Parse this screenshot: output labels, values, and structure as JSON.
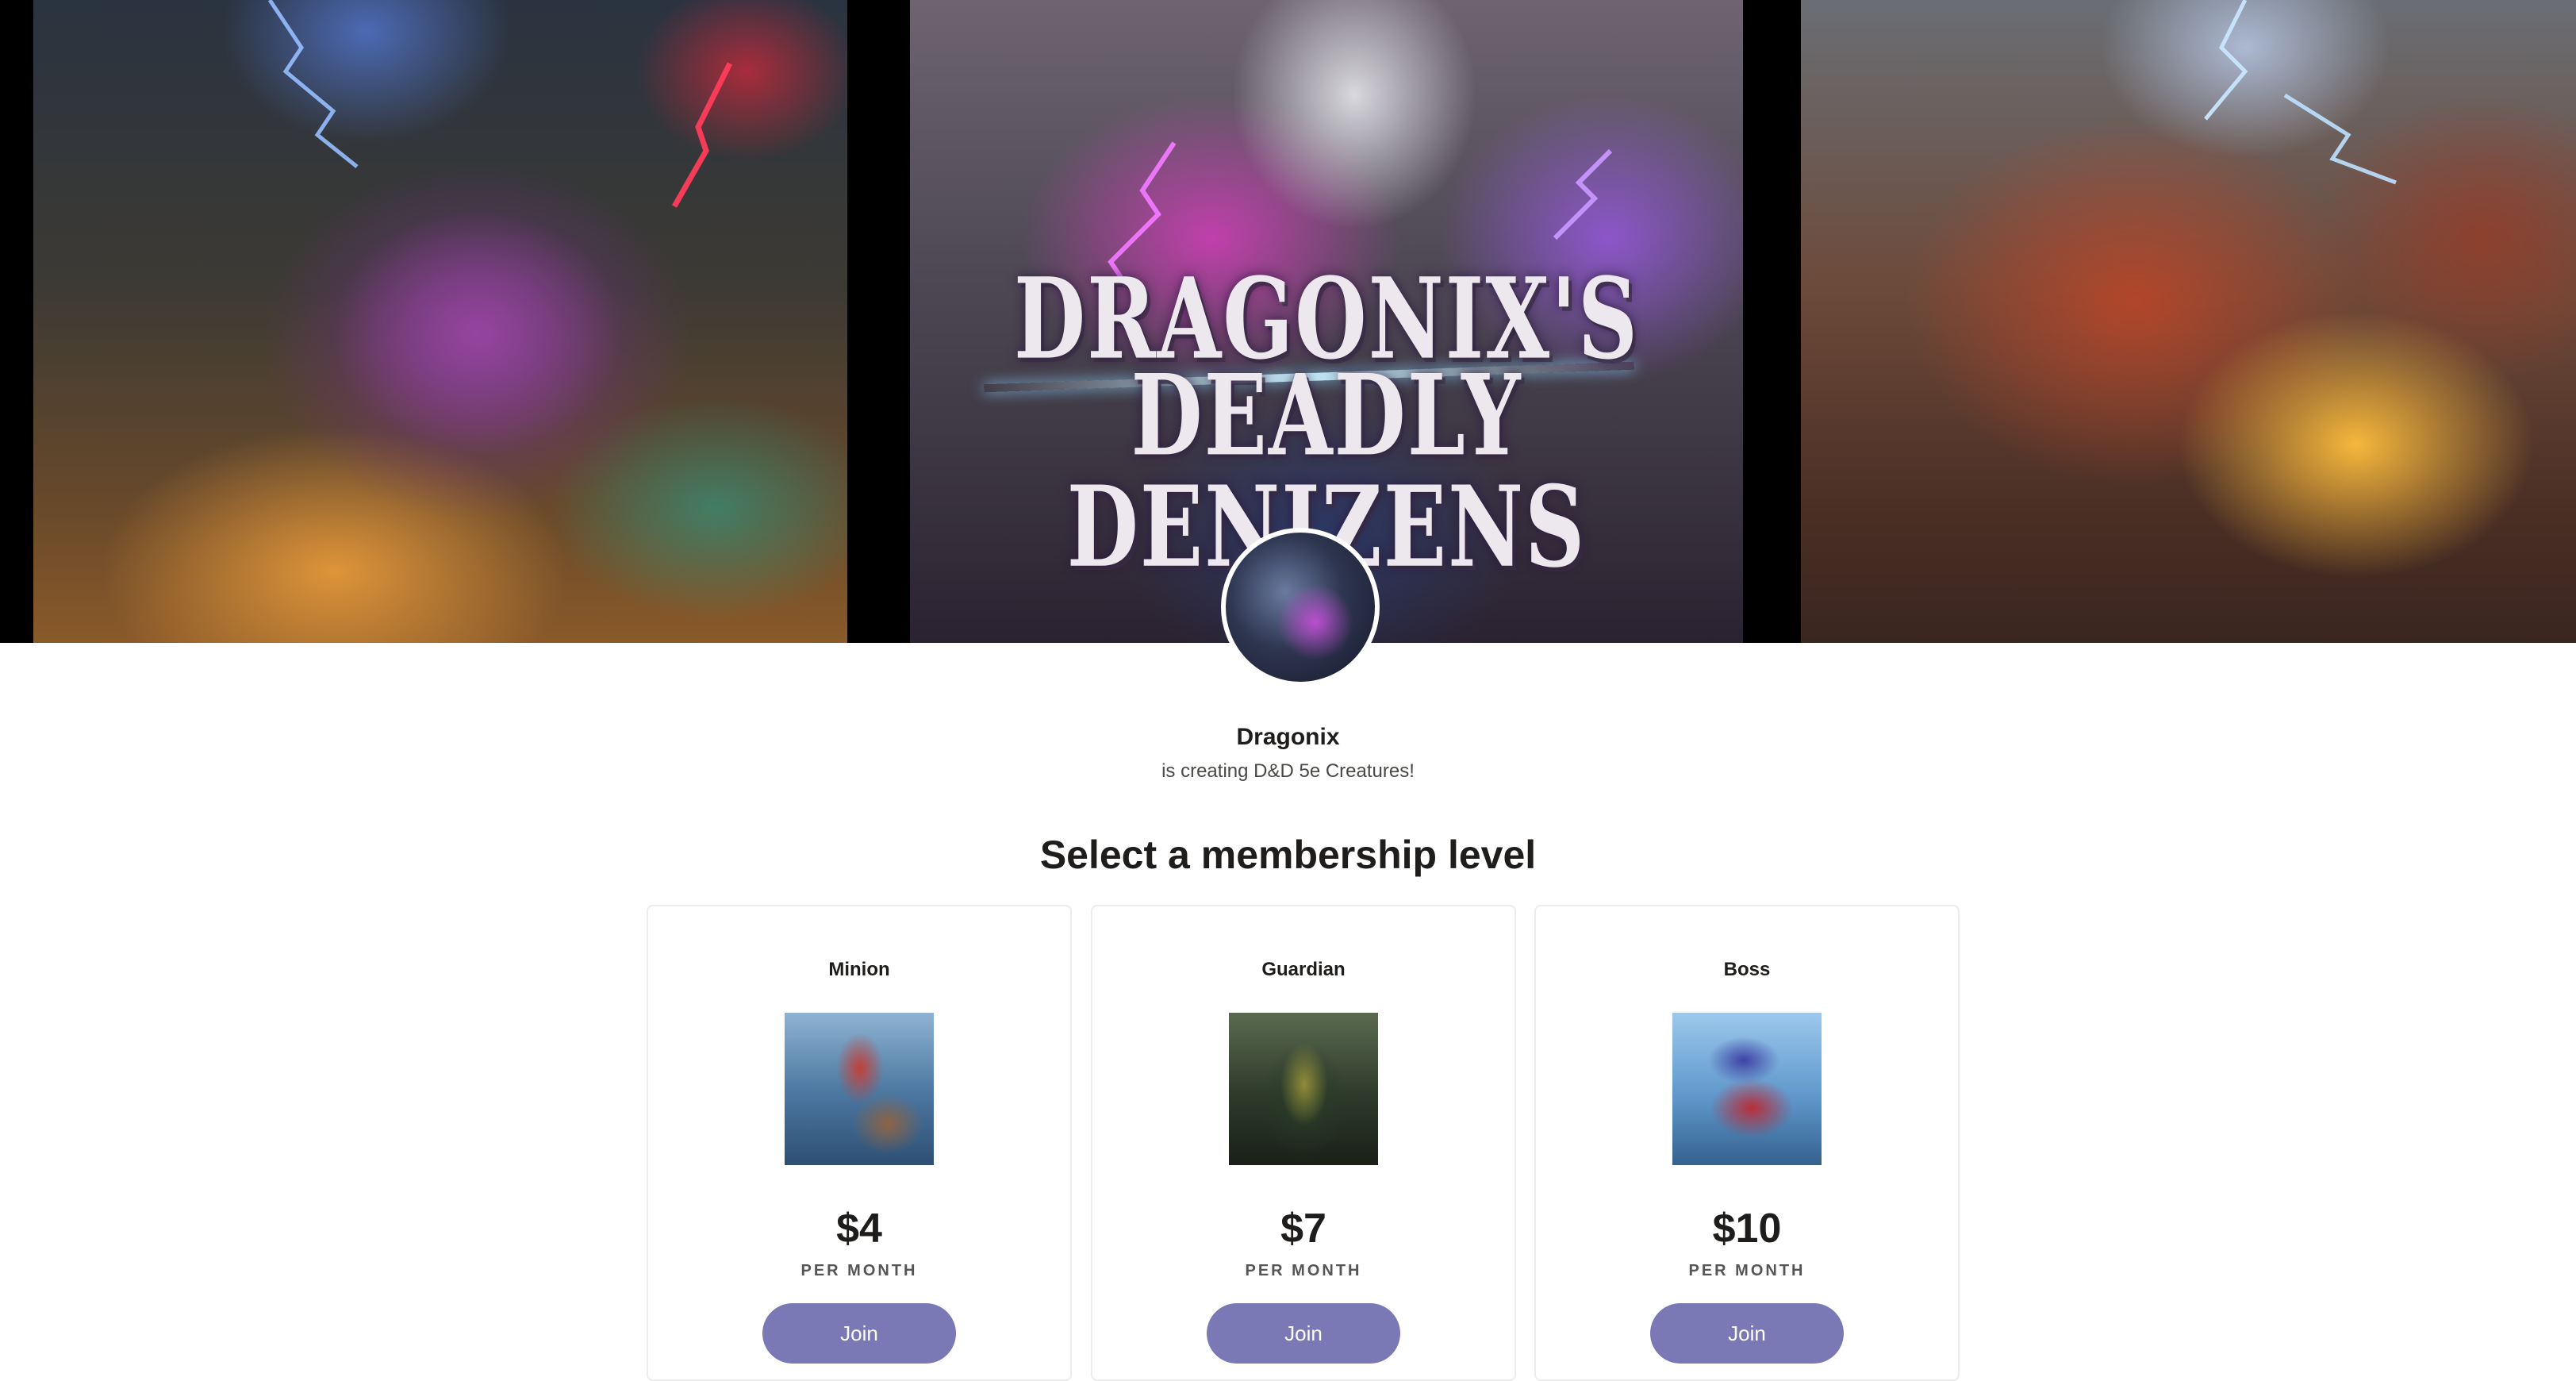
{
  "banner": {
    "title_line1": "DRAGONIX'S",
    "title_line2": "DEADLY DENIZENS"
  },
  "creator": {
    "name": "Dragonix",
    "tagline": "is creating D&D 5e Creatures!"
  },
  "membership": {
    "heading": "Select a membership level",
    "tiers": [
      {
        "name": "Minion",
        "price": "$4",
        "period": "PER MONTH",
        "button": "Join"
      },
      {
        "name": "Guardian",
        "price": "$7",
        "period": "PER MONTH",
        "button": "Join"
      },
      {
        "name": "Boss",
        "price": "$10",
        "period": "PER MONTH",
        "button": "Join"
      }
    ]
  },
  "colors": {
    "accent": "#7b79b5",
    "text": "#1f1d1b",
    "card_border": "#ececec"
  }
}
